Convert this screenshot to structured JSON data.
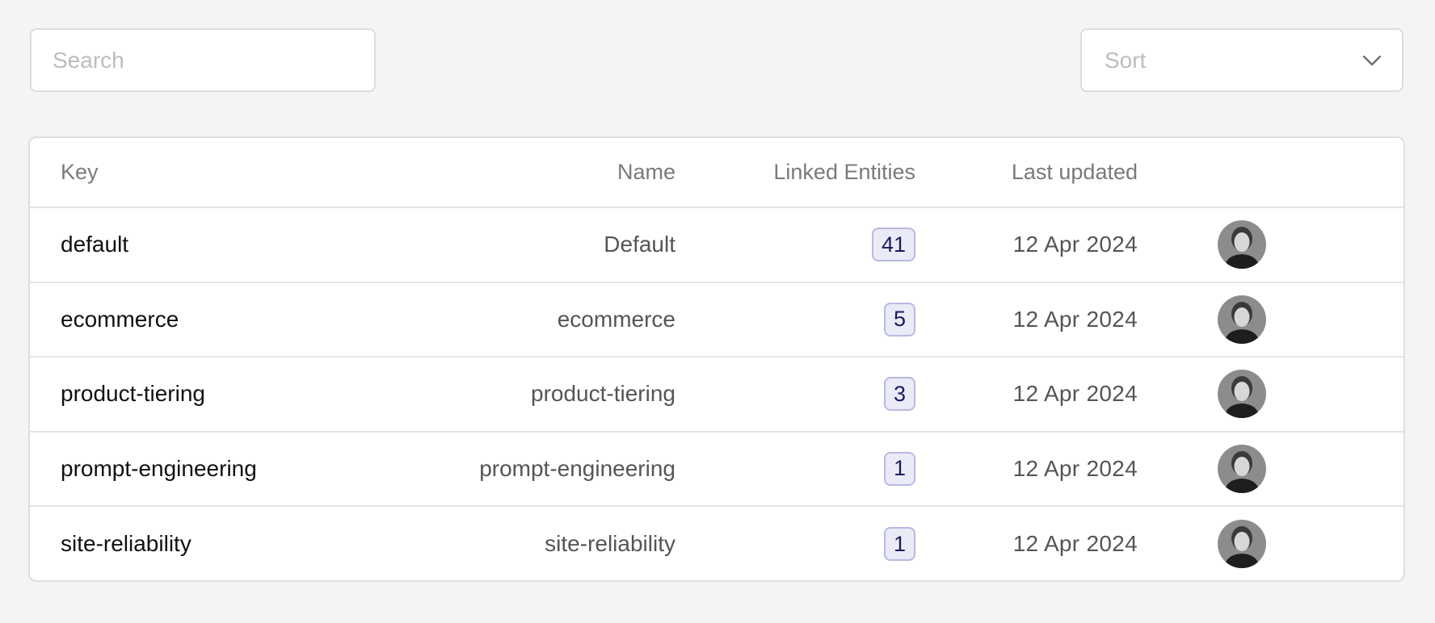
{
  "search": {
    "placeholder": "Search",
    "value": ""
  },
  "sort": {
    "label": "Sort",
    "icon": "chevron-down-icon"
  },
  "table": {
    "columns": {
      "key": "Key",
      "name": "Name",
      "linked": "Linked Entities",
      "updated": "Last updated"
    },
    "rows": [
      {
        "key": "default",
        "name": "Default",
        "linked": "41",
        "updated": "12 Apr 2024"
      },
      {
        "key": "ecommerce",
        "name": "ecommerce",
        "linked": "5",
        "updated": "12 Apr 2024"
      },
      {
        "key": "product-tiering",
        "name": "product-tiering",
        "linked": "3",
        "updated": "12 Apr 2024"
      },
      {
        "key": "prompt-engineering",
        "name": "prompt-engineering",
        "linked": "1",
        "updated": "12 Apr 2024"
      },
      {
        "key": "site-reliability",
        "name": "site-reliability",
        "linked": "1",
        "updated": "12 Apr 2024"
      }
    ]
  },
  "colors": {
    "page_background": "#f4f4f3",
    "badge_background": "#ebebf8",
    "badge_border": "#b9b9e3",
    "badge_text": "#1b1b5e"
  }
}
